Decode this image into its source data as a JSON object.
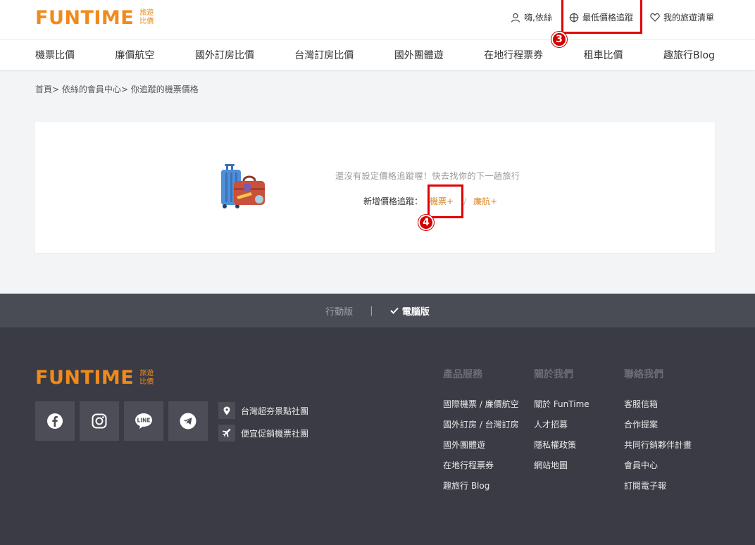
{
  "header": {
    "logo": "FUNTIME",
    "logo_sub1": "旅遊",
    "logo_sub2": "比價",
    "greeting": "嗨,依絲",
    "price_tracking": "最低價格追蹤",
    "wishlist": "我的旅遊清單"
  },
  "nav": {
    "items": [
      "機票比價",
      "廉價航空",
      "國外訂房比價",
      "台灣訂房比價",
      "國外團體遊",
      "在地行程票券",
      "租車比價",
      "趣旅行Blog"
    ]
  },
  "breadcrumb": "首頁> 依絲的會員中心> 你追蹤的機票價格",
  "main": {
    "empty_message": "還沒有設定價格追蹤喔！快去找你的下一趟旅行",
    "add_label": "新增價格追蹤：",
    "flight_link": "機票+",
    "separator": "/",
    "lcc_link": "廉航+"
  },
  "annotations": {
    "step3": "3",
    "step4": "4"
  },
  "version": {
    "mobile": "行動版",
    "separator": "|",
    "desktop": "電腦版"
  },
  "footer": {
    "logo": "FUNTIME",
    "logo_sub1": "旅遊",
    "logo_sub2": "比價",
    "communities": [
      "台灣超夯景點社團",
      "便宜促銷機票社團"
    ],
    "col1": {
      "title": "產品服務",
      "links": [
        "國際機票 / 廉價航空",
        "國外訂房 / 台灣訂房",
        "國外團體遊",
        "在地行程票券",
        "趣旅行 Blog"
      ]
    },
    "col2": {
      "title": "關於我們",
      "links": [
        "關於 FunTime",
        "人才招募",
        "隱私權政策",
        "網站地圖"
      ]
    },
    "col3": {
      "title": "聯絡我們",
      "links": [
        "客服信箱",
        "合作提案",
        "共同行銷夥伴計畫",
        "會員中心",
        "訂閱電子報"
      ]
    }
  },
  "colors": {
    "brand_orange": "#f08a1c",
    "annotation_red": "#e10000",
    "footer_bg": "#3a3b44"
  }
}
